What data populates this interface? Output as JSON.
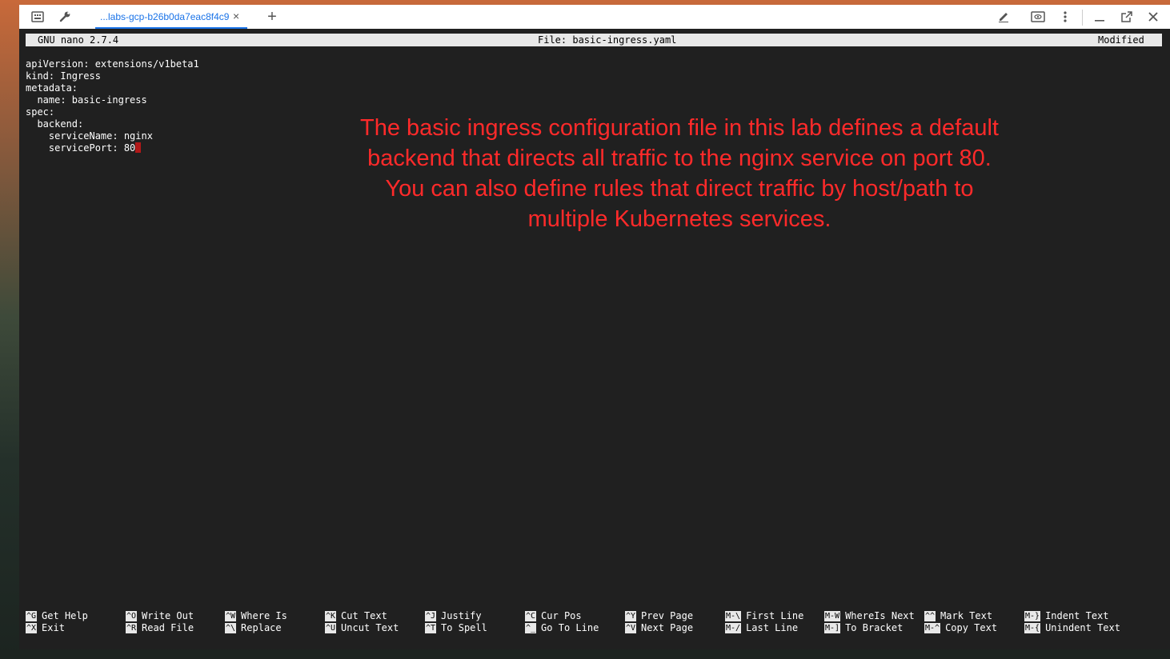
{
  "toolbar": {
    "tab_title": "...labs-gcp-b26b0da7eac8f4c9",
    "tab_close": "×",
    "new_tab": "+"
  },
  "nano": {
    "version": "GNU nano 2.7.4",
    "file_label": "File: basic-ingress.yaml",
    "status": "Modified"
  },
  "code_lines": [
    "apiVersion: extensions/v1beta1",
    "kind: Ingress",
    "metadata:",
    "  name: basic-ingress",
    "spec:",
    "  backend:",
    "    serviceName: nginx",
    "    servicePort: 80"
  ],
  "annotation": [
    "The basic ingress configuration file in this lab defines a default",
    "backend that directs all traffic to the nginx service on port 80.",
    "You can also define rules that direct traffic by host/path to",
    "multiple Kubernetes services."
  ],
  "shortcuts": [
    {
      "key": "^G",
      "label": "Get Help"
    },
    {
      "key": "^X",
      "label": "Exit"
    },
    {
      "key": "^O",
      "label": "Write Out"
    },
    {
      "key": "^R",
      "label": "Read File"
    },
    {
      "key": "^W",
      "label": "Where Is"
    },
    {
      "key": "^\\",
      "label": "Replace"
    },
    {
      "key": "^K",
      "label": "Cut Text"
    },
    {
      "key": "^U",
      "label": "Uncut Text"
    },
    {
      "key": "^J",
      "label": "Justify"
    },
    {
      "key": "^T",
      "label": "To Spell"
    },
    {
      "key": "^C",
      "label": "Cur Pos"
    },
    {
      "key": "^_",
      "label": "Go To Line"
    },
    {
      "key": "^Y",
      "label": "Prev Page"
    },
    {
      "key": "^V",
      "label": "Next Page"
    },
    {
      "key": "M-\\",
      "label": "First Line"
    },
    {
      "key": "M-/",
      "label": "Last Line"
    },
    {
      "key": "M-W",
      "label": "WhereIs Next"
    },
    {
      "key": "M-]",
      "label": "To Bracket"
    },
    {
      "key": "^^",
      "label": "Mark Text"
    },
    {
      "key": "M-^",
      "label": "Copy Text"
    },
    {
      "key": "M-}",
      "label": "Indent Text"
    },
    {
      "key": "M-{",
      "label": "Unindent Text"
    }
  ]
}
